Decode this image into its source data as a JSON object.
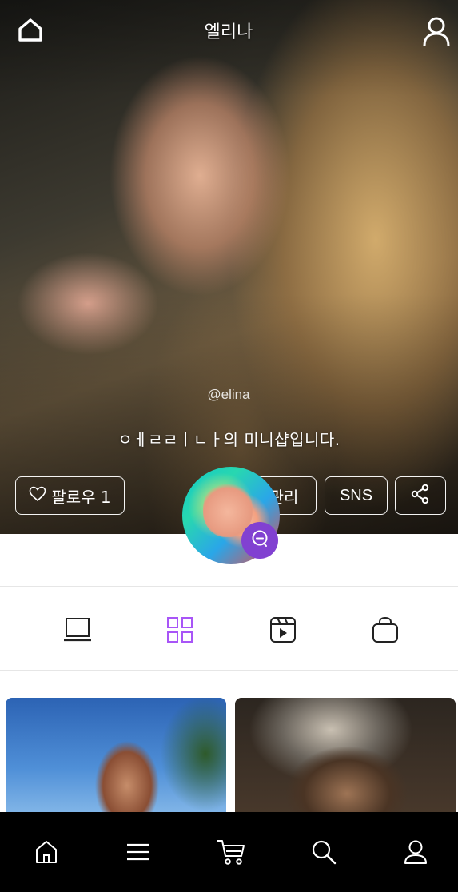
{
  "header": {
    "title": "엘리나",
    "home_icon": "home-icon",
    "user_icon": "user-icon"
  },
  "profile": {
    "handle": "@elina",
    "intro": "ㅇㅔㄹㄹㅣㄴㅏ의 미니샵입니다.",
    "follow_label": "팔로우 1",
    "manage_label": "관리",
    "sns_label": "SNS",
    "share_icon": "share-icon",
    "chat_icon": "chat-icon"
  },
  "tabs": [
    {
      "icon": "monitor-icon",
      "active": false
    },
    {
      "icon": "grid-icon",
      "active": true
    },
    {
      "icon": "video-icon",
      "active": false
    },
    {
      "icon": "bag-icon",
      "active": false
    }
  ],
  "bottom_nav": [
    {
      "icon": "home-icon"
    },
    {
      "icon": "menu-icon"
    },
    {
      "icon": "cart-icon"
    },
    {
      "icon": "search-icon"
    },
    {
      "icon": "user-icon"
    }
  ],
  "colors": {
    "accent": "#8141d1",
    "tab_active": "#a855f7",
    "nav_background": "#000000"
  }
}
